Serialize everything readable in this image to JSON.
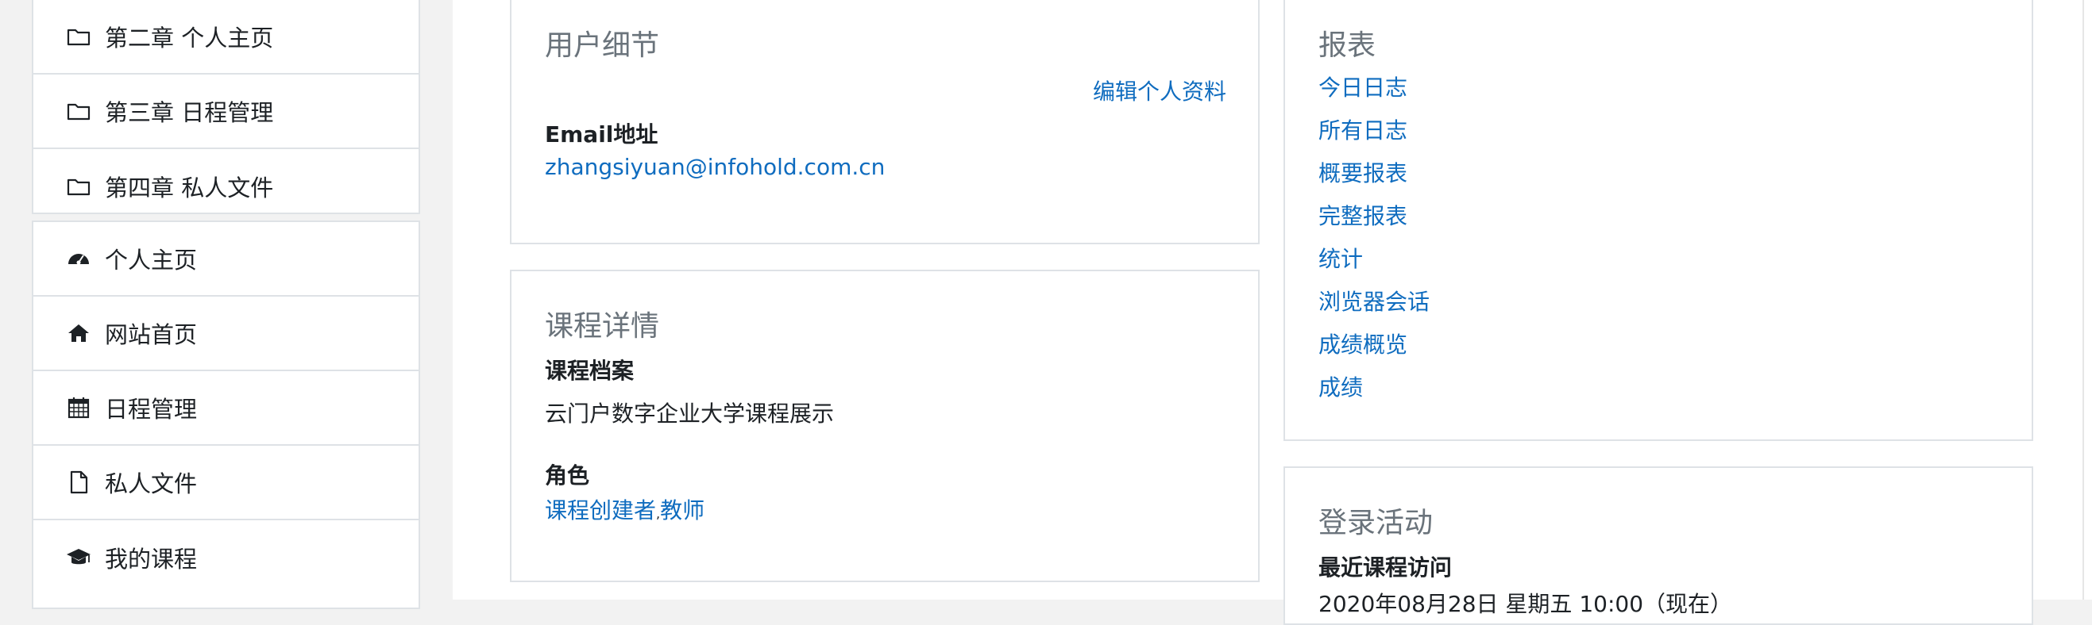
{
  "sidebar": {
    "section_items": [
      {
        "label": "第二章 个人主页",
        "icon": "folder-icon"
      },
      {
        "label": "第三章 日程管理",
        "icon": "folder-icon"
      },
      {
        "label": "第四章 私人文件",
        "icon": "folder-icon"
      }
    ],
    "main_items": [
      {
        "label": "个人主页",
        "icon": "dashboard-icon"
      },
      {
        "label": "网站首页",
        "icon": "home-icon"
      },
      {
        "label": "日程管理",
        "icon": "calendar-icon"
      },
      {
        "label": "私人文件",
        "icon": "file-icon"
      },
      {
        "label": "我的课程",
        "icon": "graduation-cap-icon"
      }
    ]
  },
  "user_details": {
    "title": "用户细节",
    "edit_link": "编辑个人资料",
    "email_label": "Email地址",
    "email_value": "zhangsiyuan@infohold.com.cn"
  },
  "course_details": {
    "title": "课程详情",
    "profile_label": "课程档案",
    "profile_value": "云门户数字企业大学课程展示",
    "roles_label": "角色",
    "roles": [
      "课程创建者",
      "教师"
    ],
    "roles_separator": ","
  },
  "reports": {
    "title": "报表",
    "links": [
      "今日日志",
      "所有日志",
      "概要报表",
      "完整报表",
      "统计",
      "浏览器会话",
      "成绩概览",
      "成绩"
    ]
  },
  "login_activity": {
    "title": "登录活动",
    "recent_access_label": "最近课程访问",
    "recent_access_value": "2020年08月28日 星期五 10:00（现在）"
  },
  "colors": {
    "link": "#0f6cbf",
    "border": "#dee2e6",
    "drawer_bg": "#f2f2f2"
  }
}
